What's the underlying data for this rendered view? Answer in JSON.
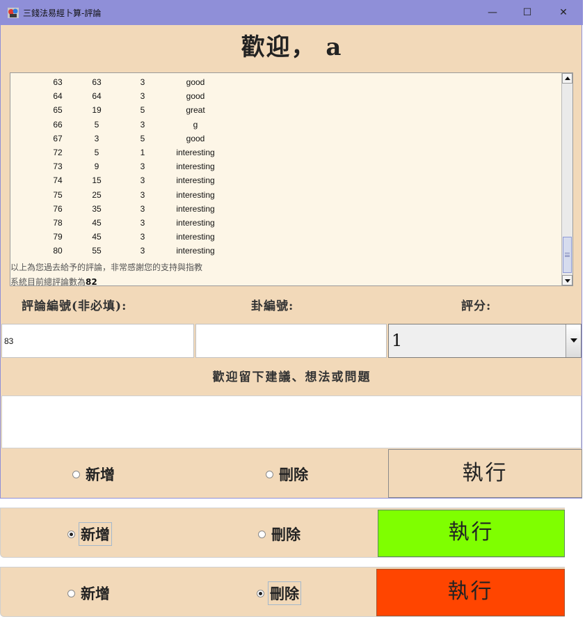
{
  "window": {
    "title": "三錢法易經卜算-評論",
    "controls": {
      "minimize": "—",
      "maximize": "☐",
      "close": "✕"
    }
  },
  "welcome": "歡迎， a",
  "history": {
    "rows": [
      {
        "no": "63",
        "gua": "63",
        "score": "3",
        "comment": "good"
      },
      {
        "no": "64",
        "gua": "64",
        "score": "3",
        "comment": "good"
      },
      {
        "no": "65",
        "gua": "19",
        "score": "5",
        "comment": "great"
      },
      {
        "no": "66",
        "gua": "5",
        "score": "3",
        "comment": "g"
      },
      {
        "no": "67",
        "gua": "3",
        "score": "5",
        "comment": "good"
      },
      {
        "no": "72",
        "gua": "5",
        "score": "1",
        "comment": "interesting"
      },
      {
        "no": "73",
        "gua": "9",
        "score": "3",
        "comment": "interesting"
      },
      {
        "no": "74",
        "gua": "15",
        "score": "3",
        "comment": "interesting"
      },
      {
        "no": "75",
        "gua": "25",
        "score": "3",
        "comment": "interesting"
      },
      {
        "no": "76",
        "gua": "35",
        "score": "3",
        "comment": "interesting"
      },
      {
        "no": "78",
        "gua": "45",
        "score": "3",
        "comment": "interesting"
      },
      {
        "no": "79",
        "gua": "45",
        "score": "3",
        "comment": "interesting"
      },
      {
        "no": "80",
        "gua": "55",
        "score": "3",
        "comment": "interesting"
      }
    ],
    "thanks_note": "以上為您過去給予的評論，非常感謝您的支持與指教",
    "total_prefix": "系統目前總評論數為",
    "total_count": "82"
  },
  "form": {
    "comment_no_label": "評論編號(非必填):",
    "gua_no_label": "卦編號:",
    "score_label": "評分:",
    "comment_no_value": "83",
    "gua_no_value": "",
    "score_value": "1",
    "suggestion_label": "歡迎留下建議、想法或問題",
    "suggestion_value": ""
  },
  "actions": {
    "add_label": "新增",
    "delete_label": "刪除",
    "execute_label": "執行",
    "execute_colors": {
      "add_mode": "#7fff00",
      "delete_mode": "#ff4500",
      "default": "#f2d9b9"
    },
    "states": [
      {
        "selected": "none"
      },
      {
        "selected": "add"
      },
      {
        "selected": "delete"
      }
    ]
  }
}
